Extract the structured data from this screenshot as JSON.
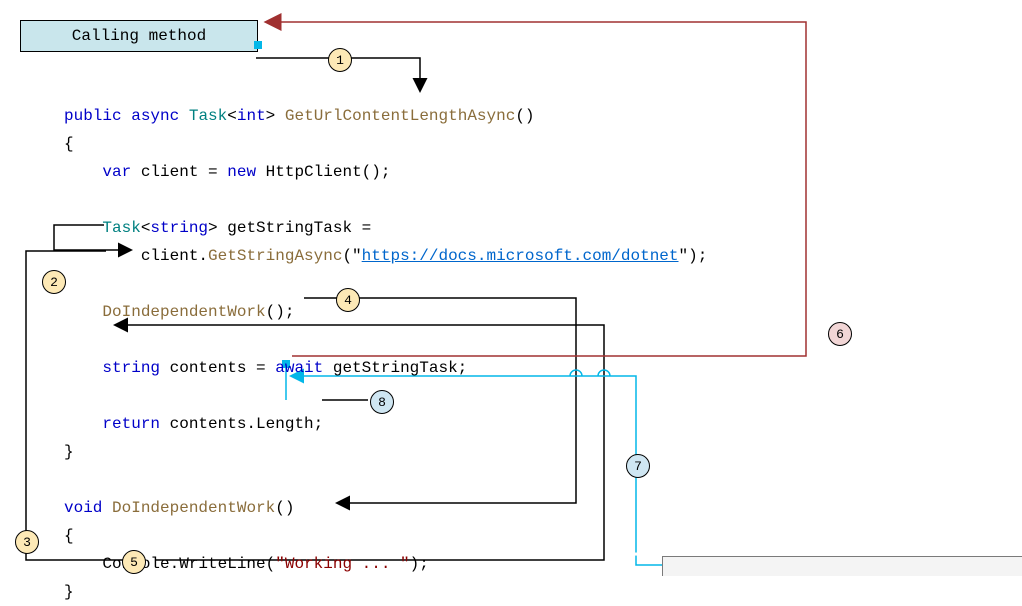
{
  "calling_method_label": "Calling method",
  "code": {
    "public": "public",
    "async": "async",
    "task": "Task",
    "lt": "<",
    "int": "int",
    "gt": ">",
    "geturl": "GetUrlContentLengthAsync",
    "parens": "()",
    "lbrace": "{",
    "var": "var",
    "client": " client = ",
    "new": "new",
    "httpclient": " HttpClient",
    "eolparens": "();",
    "task2": "Task",
    "string": "string",
    "getstringtask": " getStringTask =",
    "clientdot": "client.",
    "getstringasync": "GetStringAsync",
    "openstr": "(\"",
    "url": "https://docs.microsoft.com/dotnet",
    "closestr": "\");",
    "doindwork": "DoIndependentWork",
    "callend": "();",
    "string2": "string",
    "contentseq": " contents = ",
    "await": "await",
    "getstringtaskvar": " getStringTask;",
    "return": "return",
    "contentslen": " contents.Length;",
    "rbrace": "}",
    "void": "void",
    "doindwork2": "DoIndependentWork",
    "consolewrite": "Console.WriteLine(",
    "workingstr": "\"Working ... \"",
    "rparensemi": ");"
  },
  "steps": {
    "one": "1",
    "two": "2",
    "three": "3",
    "four": "4",
    "five": "5",
    "six": "6",
    "seven": "7",
    "eight": "8"
  }
}
